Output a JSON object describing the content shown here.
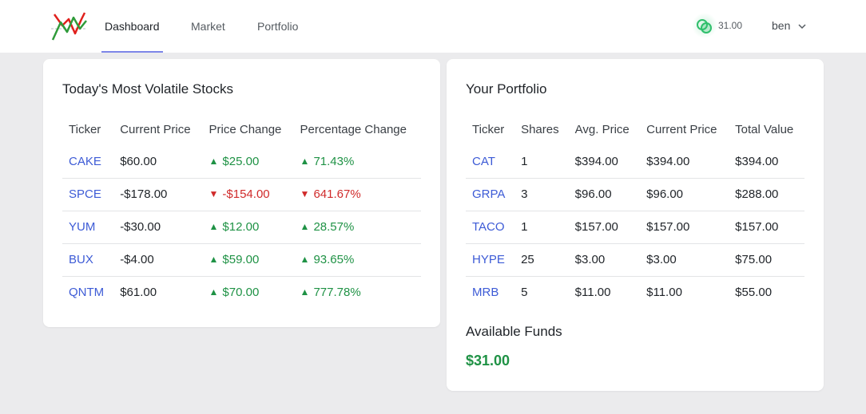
{
  "nav": {
    "items": [
      {
        "label": "Dashboard"
      },
      {
        "label": "Market"
      },
      {
        "label": "Portfolio"
      }
    ],
    "balance": "31.00",
    "user": "ben",
    "icons": {
      "logo": "stock-chart-logo",
      "coin": "coins-icon",
      "chevron": "chevron-down-icon"
    }
  },
  "volatile": {
    "title": "Today's Most Volatile Stocks",
    "headers": [
      "Ticker",
      "Current Price",
      "Price Change",
      "Percentage Change"
    ],
    "rows": [
      {
        "ticker": "CAKE",
        "price": "$60.00",
        "change": "$25.00",
        "pct": "71.43%",
        "dir": "up"
      },
      {
        "ticker": "SPCE",
        "price": "-$178.00",
        "change": "-$154.00",
        "pct": "641.67%",
        "dir": "down"
      },
      {
        "ticker": "YUM",
        "price": "-$30.00",
        "change": "$12.00",
        "pct": "28.57%",
        "dir": "up"
      },
      {
        "ticker": "BUX",
        "price": "-$4.00",
        "change": "$59.00",
        "pct": "93.65%",
        "dir": "up"
      },
      {
        "ticker": "QNTM",
        "price": "$61.00",
        "change": "$70.00",
        "pct": "777.78%",
        "dir": "up"
      }
    ]
  },
  "portfolio": {
    "title": "Your Portfolio",
    "headers": [
      "Ticker",
      "Shares",
      "Avg. Price",
      "Current Price",
      "Total Value"
    ],
    "rows": [
      {
        "ticker": "CAT",
        "shares": "1",
        "avg": "$394.00",
        "current": "$394.00",
        "total": "$394.00"
      },
      {
        "ticker": "GRPA",
        "shares": "3",
        "avg": "$96.00",
        "current": "$96.00",
        "total": "$288.00"
      },
      {
        "ticker": "TACO",
        "shares": "1",
        "avg": "$157.00",
        "current": "$157.00",
        "total": "$157.00"
      },
      {
        "ticker": "HYPE",
        "shares": "25",
        "avg": "$3.00",
        "current": "$3.00",
        "total": "$75.00"
      },
      {
        "ticker": "MRB",
        "shares": "5",
        "avg": "$11.00",
        "current": "$11.00",
        "total": "$55.00"
      }
    ],
    "funds_label": "Available Funds",
    "funds_value": "$31.00"
  },
  "colors": {
    "up": "#1f9245",
    "down": "#d02b2b",
    "link": "#3d5bd6",
    "nav_active": "#7d86e8"
  }
}
